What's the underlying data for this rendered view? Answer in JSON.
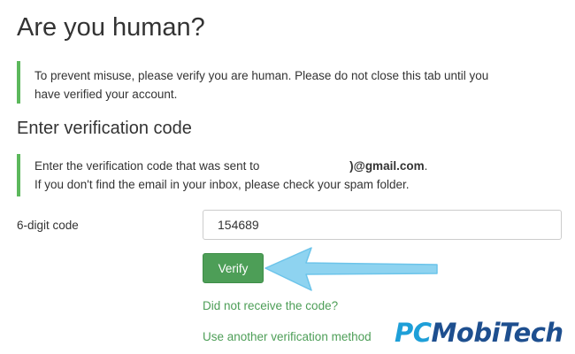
{
  "page": {
    "title": "Are you human?",
    "intro": "To prevent misuse, please verify you are human. Please do not close this tab until you have verified your account."
  },
  "verification": {
    "section_title": "Enter verification code",
    "info_prefix": "Enter the verification code that was sent to ",
    "email_visible": ")@gmail.com",
    "info_period": ".",
    "info_line2": "If you don't find the email in your inbox, please check your spam folder.",
    "code_label": "6-digit code",
    "code_value": "154689",
    "verify_label": "Verify",
    "resend_link": "Did not receive the code?",
    "alt_method_link": "Use another verification method"
  },
  "watermark": {
    "part1": "PC",
    "part2": "MobiTech"
  },
  "colors": {
    "accent_green": "#4d9e57",
    "callout_border": "#5cb85c",
    "arrow": "#8ed3f0"
  }
}
